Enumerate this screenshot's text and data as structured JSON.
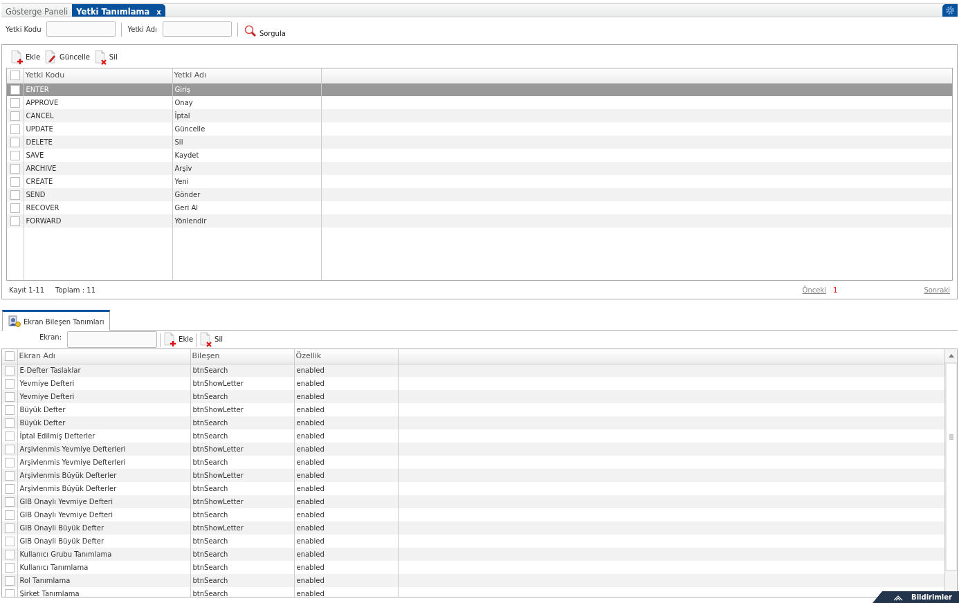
{
  "tabs": [
    {
      "label": "Gösterge Paneli",
      "selected": false
    },
    {
      "label": "Yetki Tanımlama",
      "selected": true,
      "close": "x"
    }
  ],
  "filters": [
    {
      "label": "Yetki Kodu"
    },
    {
      "label": "Yetki Adı"
    }
  ],
  "query_button": "Sorgula",
  "toolbar": [
    {
      "kind": "add",
      "label": "Ekle"
    },
    {
      "kind": "edit",
      "label": "Güncelle"
    },
    {
      "kind": "delete",
      "label": "Sil"
    }
  ],
  "grid": {
    "columns": [
      "Yetki Kodu",
      "Yetki Adı"
    ],
    "header_checked": false,
    "rows": [
      {
        "cells": [
          "ENTER",
          "Giriş"
        ],
        "selected": true,
        "checked": false
      },
      {
        "cells": [
          "APPROVE",
          "Onay"
        ],
        "selected": false,
        "checked": false
      },
      {
        "cells": [
          "CANCEL",
          "İptal"
        ],
        "selected": false,
        "checked": false
      },
      {
        "cells": [
          "UPDATE",
          "Güncelle"
        ],
        "selected": false,
        "checked": false
      },
      {
        "cells": [
          "DELETE",
          "Sil"
        ],
        "selected": false,
        "checked": false
      },
      {
        "cells": [
          "SAVE",
          "Kaydet"
        ],
        "selected": false,
        "checked": false
      },
      {
        "cells": [
          "ARCHIVE",
          "Arşiv"
        ],
        "selected": false,
        "checked": false
      },
      {
        "cells": [
          "CREATE",
          "Yeni"
        ],
        "selected": false,
        "checked": false
      },
      {
        "cells": [
          "SEND",
          "Gönder"
        ],
        "selected": false,
        "checked": false
      },
      {
        "cells": [
          "RECOVER",
          "Geri Al"
        ],
        "selected": false,
        "checked": false
      },
      {
        "cells": [
          "FORWARD",
          "Yönlendir"
        ],
        "selected": false,
        "checked": false
      }
    ]
  },
  "pager": {
    "records": "Kayıt 1-11",
    "total": "Toplam : 11",
    "previous": "Önceki",
    "page": "1",
    "next": "Sonraki"
  },
  "section_tab": "Ekran Bileşen Tanımları",
  "section_filter": {
    "label": "Ekran:"
  },
  "section_toolbar": [
    {
      "kind": "add",
      "label": "Ekle"
    },
    {
      "kind": "delete",
      "label": "Sil"
    }
  ],
  "section_grid": {
    "columns": [
      "Ekran Adı",
      "Bileşen",
      "Özellik"
    ],
    "header_checked": false,
    "rows": [
      {
        "cells": [
          "E-Defter Taslaklar",
          "btnSearch",
          "enabled"
        ],
        "checked": false
      },
      {
        "cells": [
          "Yevmiye Defteri",
          "btnShowLetter",
          "enabled"
        ],
        "checked": false
      },
      {
        "cells": [
          "Yevmiye Defteri",
          "btnSearch",
          "enabled"
        ],
        "checked": false
      },
      {
        "cells": [
          "Büyük Defter",
          "btnShowLetter",
          "enabled"
        ],
        "checked": false
      },
      {
        "cells": [
          "Büyük Defter",
          "btnSearch",
          "enabled"
        ],
        "checked": false
      },
      {
        "cells": [
          "İptal Edilmiş Defterler",
          "btnSearch",
          "enabled"
        ],
        "checked": false
      },
      {
        "cells": [
          "Arşivlenmis Yevmiye Defterleri",
          "btnShowLetter",
          "enabled"
        ],
        "checked": false
      },
      {
        "cells": [
          "Arşivlenmis Yevmiye Defterleri",
          "btnSearch",
          "enabled"
        ],
        "checked": false
      },
      {
        "cells": [
          "Arşivlenmis Büyük Defterler",
          "btnShowLetter",
          "enabled"
        ],
        "checked": false
      },
      {
        "cells": [
          "Arşivlenmis Büyük Defterler",
          "btnSearch",
          "enabled"
        ],
        "checked": false
      },
      {
        "cells": [
          "GIB Onaylı Yevmiye Defteri",
          "btnShowLetter",
          "enabled"
        ],
        "checked": false
      },
      {
        "cells": [
          "GIB Onaylı Yevmiye Defteri",
          "btnSearch",
          "enabled"
        ],
        "checked": false
      },
      {
        "cells": [
          "GIB Onayli Büyük Defter",
          "btnShowLetter",
          "enabled"
        ],
        "checked": false
      },
      {
        "cells": [
          "GIB Onayli Büyük Defter",
          "btnSearch",
          "enabled"
        ],
        "checked": false
      },
      {
        "cells": [
          "Kullanıcı Grubu Tanımlama",
          "btnSearch",
          "enabled"
        ],
        "checked": false
      },
      {
        "cells": [
          "Kullanıcı Tanımlama",
          "btnSearch",
          "enabled"
        ],
        "checked": false
      },
      {
        "cells": [
          "Rol Tanımlama",
          "btnSearch",
          "enabled"
        ],
        "checked": false
      },
      {
        "cells": [
          "Şirket Tanımlama",
          "btnSearch",
          "enabled"
        ],
        "checked": false
      }
    ]
  },
  "notifications": "Bildirimler"
}
